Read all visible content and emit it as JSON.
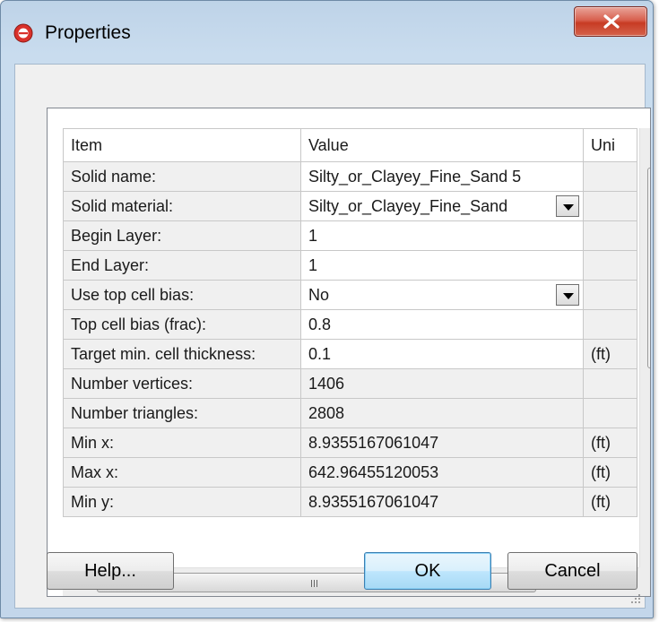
{
  "window": {
    "title": "Properties",
    "icon": "app-logo-icon"
  },
  "grid": {
    "headers": {
      "item": "Item",
      "value": "Value",
      "unit": "Uni"
    },
    "rows": [
      {
        "item": "Solid name:",
        "value": "Silty_or_Clayey_Fine_Sand 5",
        "unit": "",
        "editable": true,
        "dropdown": false
      },
      {
        "item": "Solid material:",
        "value": "Silty_or_Clayey_Fine_Sand",
        "unit": "",
        "editable": true,
        "dropdown": true
      },
      {
        "item": "Begin Layer:",
        "value": "1",
        "unit": "",
        "editable": true,
        "dropdown": false
      },
      {
        "item": "End Layer:",
        "value": "1",
        "unit": "",
        "editable": true,
        "dropdown": false
      },
      {
        "item": "Use top cell bias:",
        "value": "No",
        "unit": "",
        "editable": true,
        "dropdown": true
      },
      {
        "item": "Top cell bias (frac):",
        "value": "0.8",
        "unit": "",
        "editable": true,
        "dropdown": false
      },
      {
        "item": "Target min. cell thickness:",
        "value": "0.1",
        "unit": "(ft)",
        "editable": true,
        "dropdown": false
      },
      {
        "item": "Number vertices:",
        "value": "1406",
        "unit": "",
        "editable": false,
        "dropdown": false
      },
      {
        "item": "Number triangles:",
        "value": "2808",
        "unit": "",
        "editable": false,
        "dropdown": false
      },
      {
        "item": "Min x:",
        "value": "8.9355167061047",
        "unit": "(ft)",
        "editable": false,
        "dropdown": false
      },
      {
        "item": "Max x:",
        "value": "642.96455120053",
        "unit": "(ft)",
        "editable": false,
        "dropdown": false
      },
      {
        "item": "Min y:",
        "value": "8.9355167061047",
        "unit": "(ft)",
        "editable": false,
        "dropdown": false
      }
    ]
  },
  "buttons": {
    "help": "Help...",
    "ok": "OK",
    "cancel": "Cancel"
  }
}
